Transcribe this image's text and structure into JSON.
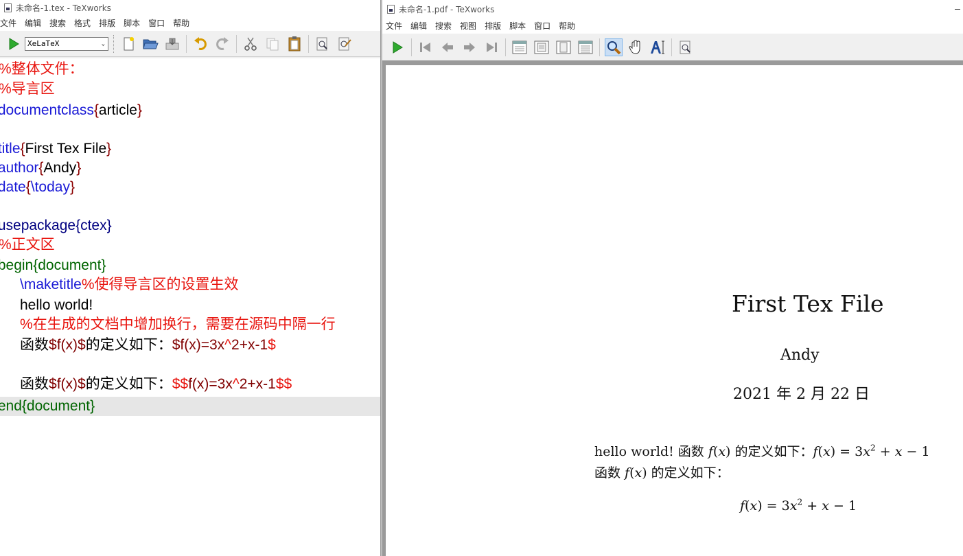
{
  "editor": {
    "window_title": "未命名-1.tex - TeXworks",
    "menu": [
      "文件",
      "编辑",
      "搜索",
      "格式",
      "排版",
      "脚本",
      "窗口",
      "帮助"
    ],
    "engine": "XeLaTeX",
    "lines": {
      "l1": "%整体文件：",
      "l2": "%导言区",
      "l3a": "\\documentclass",
      "l3b": "{",
      "l3c": "article",
      "l3d": "}",
      "l4a": "\\title",
      "l4b": "{",
      "l4c": "First Tex File",
      "l4d": "}",
      "l5a": "\\author",
      "l5b": "{",
      "l5c": "Andy",
      "l5d": "}",
      "l6a": "\\date",
      "l6b": "{",
      "l6c": "\\today",
      "l6d": "}",
      "l7": "\\usepackage{ctex}",
      "l8": "%正文区",
      "l9": "\\begin{document}",
      "l10a": "\\maketitle",
      "l10b": "%使得导言区的设置生效",
      "l11": "hello world!",
      "l12": "%在生成的文档中增加换行，需要在源码中隔一行",
      "l13a": "函数",
      "l13b": "$",
      "l13c": "f(x)",
      "l13d": "$",
      "l13e": "的定义如下：",
      "l13f": "$",
      "l13g": "f(x)=3x",
      "l13h": "^",
      "l13i": "2+x-1",
      "l13j": "$",
      "l14a": "函数",
      "l14b": "$",
      "l14c": "f(x)",
      "l14d": "$",
      "l14e": "的定义如下：",
      "l14f": "$$",
      "l14g": "f(x)=3x",
      "l14h": "^",
      "l14i": "2+x-1",
      "l14j": "$$",
      "l15": "\\end{document}"
    }
  },
  "viewer": {
    "window_title": "未命名-1.pdf - TeXworks",
    "menu": [
      "文件",
      "编辑",
      "搜索",
      "视图",
      "排版",
      "脚本",
      "窗口",
      "帮助"
    ],
    "pdf": {
      "title": "First Tex File",
      "author": "Andy",
      "date": "2021 年 2 月 22 日",
      "para1_a": "hello world! 函数 ",
      "para1_b": "f",
      "para1_c": "(",
      "para1_d": "x",
      "para1_e": ") 的定义如下：",
      "para1_f": "f",
      "para1_g": "(",
      "para1_h": "x",
      "para1_i": ") = 3",
      "para1_j": "x",
      "para1_k": "2",
      "para1_l": " + ",
      "para1_m": "x",
      "para1_n": " − 1",
      "para2_a": "函数 ",
      "para2_b": "f",
      "para2_c": "(",
      "para2_d": "x",
      "para2_e": ") 的定义如下：",
      "disp_a": "f",
      "disp_b": "(",
      "disp_c": "x",
      "disp_d": ") = 3",
      "disp_e": "x",
      "disp_f": "2",
      "disp_g": " + ",
      "disp_h": "x",
      "disp_i": " − 1"
    }
  }
}
